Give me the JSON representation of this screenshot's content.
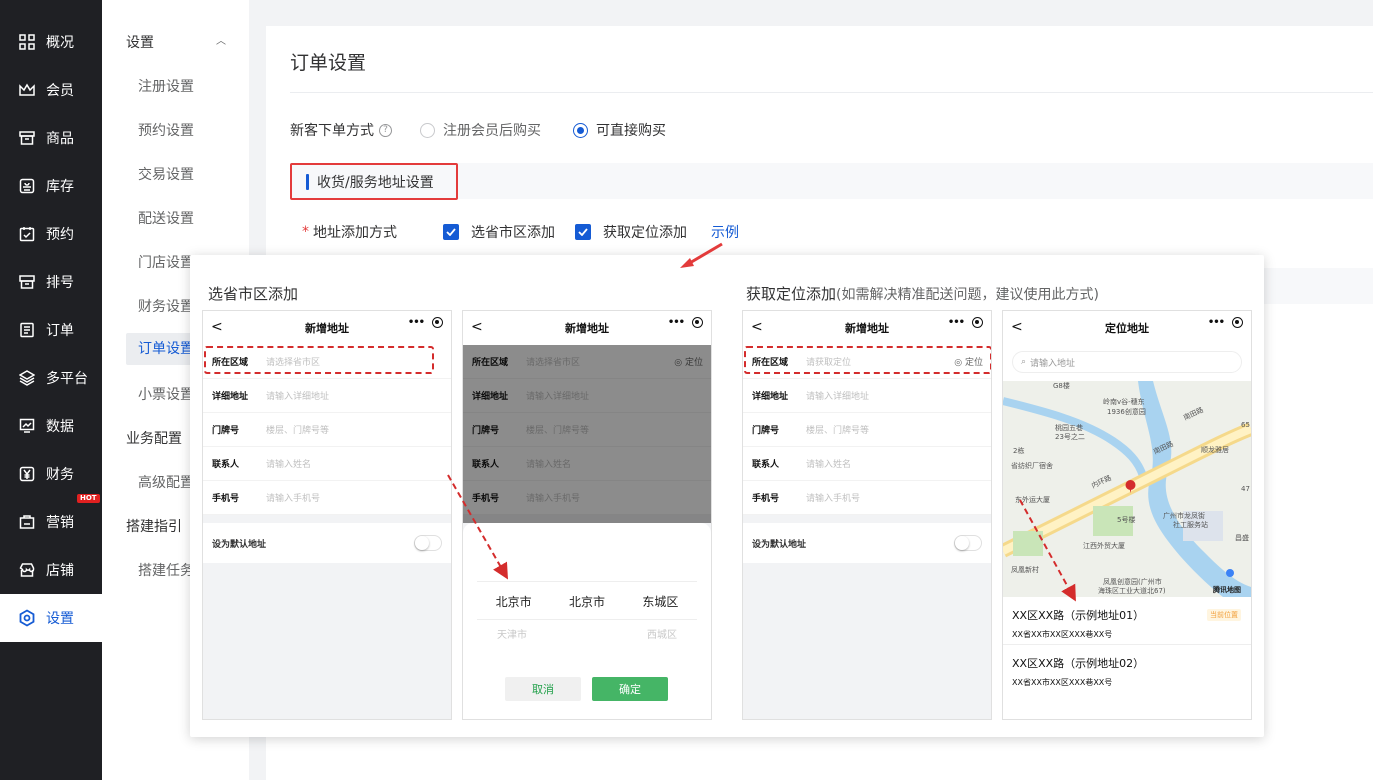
{
  "sidebar": {
    "items": [
      {
        "label": "概况",
        "icon": "grid-icon"
      },
      {
        "label": "会员",
        "icon": "crown-icon"
      },
      {
        "label": "商品",
        "icon": "shop-icon"
      },
      {
        "label": "库存",
        "icon": "inventory-icon"
      },
      {
        "label": "预约",
        "icon": "calendar-check-icon"
      },
      {
        "label": "排号",
        "icon": "queue-icon"
      },
      {
        "label": "订单",
        "icon": "order-icon"
      },
      {
        "label": "多平台",
        "icon": "layers-icon"
      },
      {
        "label": "数据",
        "icon": "chart-icon"
      },
      {
        "label": "财务",
        "icon": "yen-icon"
      },
      {
        "label": "营销",
        "icon": "marketing-icon",
        "badge": "HOT"
      },
      {
        "label": "店铺",
        "icon": "store-icon"
      },
      {
        "label": "设置",
        "icon": "settings-icon",
        "active": true
      }
    ]
  },
  "subnav": {
    "group1": "设置",
    "items1": [
      "注册设置",
      "预约设置",
      "交易设置",
      "配送设置",
      "门店设置",
      "财务设置",
      "订单设置",
      "小票设置"
    ],
    "group2": "业务配置",
    "items2": [
      "高级配置"
    ],
    "group3": "搭建指引",
    "items3": [
      "搭建任务"
    ]
  },
  "page": {
    "title": "订单设置",
    "new_customer_label": "新客下单方式",
    "help": "?",
    "radio_option1": "注册会员后购买",
    "radio_option2": "可直接购买",
    "section_title": "收货/服务地址设置",
    "address_method_label": "地址添加方式",
    "required_mark": "*",
    "checkbox1": "选省市区添加",
    "checkbox2": "获取定位添加",
    "example_link": "示例"
  },
  "popup": {
    "left_title": "选省市区添加",
    "right_title": "获取定位添加",
    "right_subtitle": "(如需解决精准配送问题，建议使用此方式)",
    "phone_title_new": "新增地址",
    "phone_title_locate": "定位地址",
    "back": "<",
    "menu_dots": "•••",
    "fields": {
      "area": "所在区域",
      "area_ph": "请选择省市区",
      "area_ph_loc": "请获取定位",
      "locate": "定位",
      "detail": "详细地址",
      "detail_ph": "请输入详细地址",
      "door": "门牌号",
      "door_ph": "楼层、门牌号等",
      "contact": "联系人",
      "contact_ph": "请输入姓名",
      "phone": "手机号",
      "phone_ph": "请输入手机号",
      "default": "设为默认地址"
    },
    "picker": {
      "row1": [
        "北京市",
        "北京市",
        "东城区"
      ],
      "row2": [
        "天津市",
        "",
        "西城区"
      ],
      "cancel": "取消",
      "confirm": "确定"
    },
    "map": {
      "search_ph": "请输入地址",
      "labels": [
        "G8楼",
        "岭南v谷-穗东",
        "1936创意园",
        "桃园五巷",
        "23号之二",
        "2栋",
        "省纺织厂宿舍",
        "东外运大厦",
        "5号楼",
        "广州市龙凤街",
        "社工服务站",
        "江西外贸大厦",
        "凤凰新村",
        "凤凰创意园(广州市",
        "海珠区工业大道北67)",
        "顺龙雅居",
        "南田路",
        "内环路",
        "南田路",
        "65",
        "47",
        "昌盛",
        "腾讯地图"
      ],
      "addr1_title": "XX区XX路（示例地址01）",
      "addr1_sub": "XX省XX市XX区XXX巷XX号",
      "addr1_badge": "当前位置",
      "addr2_title": "XX区XX路（示例地址02）",
      "addr2_sub": "XX省XX市XX区XXX巷XX号"
    }
  }
}
